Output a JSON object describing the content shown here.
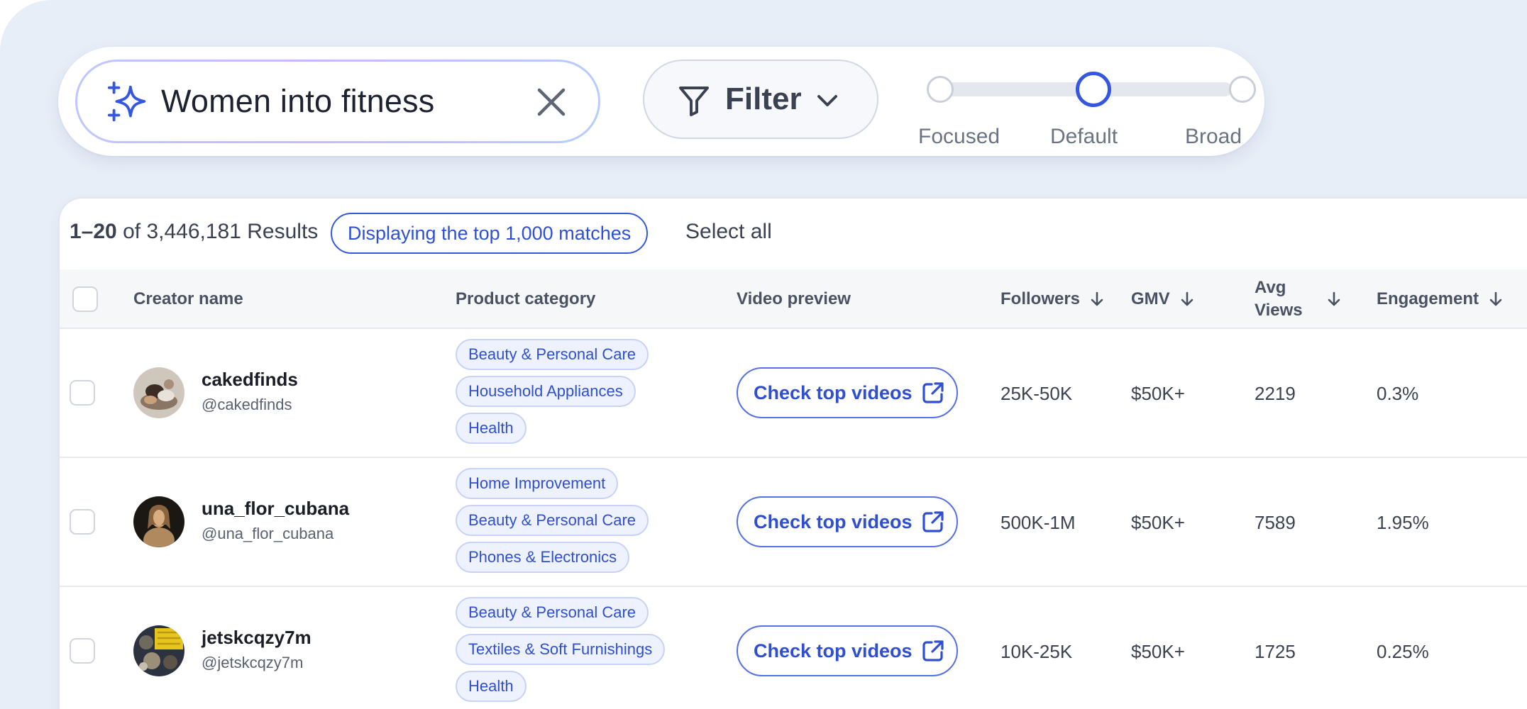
{
  "search": {
    "query": "Women into fitness",
    "filter_label": "Filter",
    "scope_options": [
      "Focused",
      "Default",
      "Broad"
    ],
    "scope_selected": "Default"
  },
  "results": {
    "count_range": "1–20",
    "count_text": "of 3,446,181 Results",
    "badge": "Displaying the top 1,000 matches",
    "select_all": "Select all"
  },
  "table": {
    "headers": {
      "creator": "Creator name",
      "category": "Product category",
      "video": "Video preview",
      "followers": "Followers",
      "gmv": "GMV",
      "avg_views": "Avg\nViews",
      "engagement": "Engagement"
    },
    "rows": [
      {
        "name": "cakedfinds",
        "handle": "@cakedfinds",
        "categories": [
          "Beauty & Personal Care",
          "Household Appliances",
          "Health"
        ],
        "video_button": "Check top videos",
        "followers": "25K-50K",
        "gmv": "$50K+",
        "avg_views": "2219",
        "engagement": "0.3%"
      },
      {
        "name": "una_flor_cubana",
        "handle": "@una_flor_cubana",
        "categories": [
          "Home Improvement",
          "Beauty & Personal Care",
          "Phones & Electronics"
        ],
        "video_button": "Check top videos",
        "followers": "500K-1M",
        "gmv": "$50K+",
        "avg_views": "7589",
        "engagement": "1.95%"
      },
      {
        "name": "jetskcqzy7m",
        "handle": "@jetskcqzy7m",
        "categories": [
          "Beauty & Personal Care",
          "Textiles & Soft Furnishings",
          "Health"
        ],
        "video_button": "Check top videos",
        "followers": "10K-25K",
        "gmv": "$50K+",
        "avg_views": "1725",
        "engagement": "0.25%"
      }
    ]
  },
  "colors": {
    "accent": "#3557e0",
    "tag_bg": "#eef2fe",
    "canvas_bg": "#e8eef8"
  },
  "icons": [
    "sparkle-icon",
    "close-icon",
    "filter-icon",
    "chevron-down-icon",
    "arrow-down-icon",
    "external-link-icon"
  ]
}
